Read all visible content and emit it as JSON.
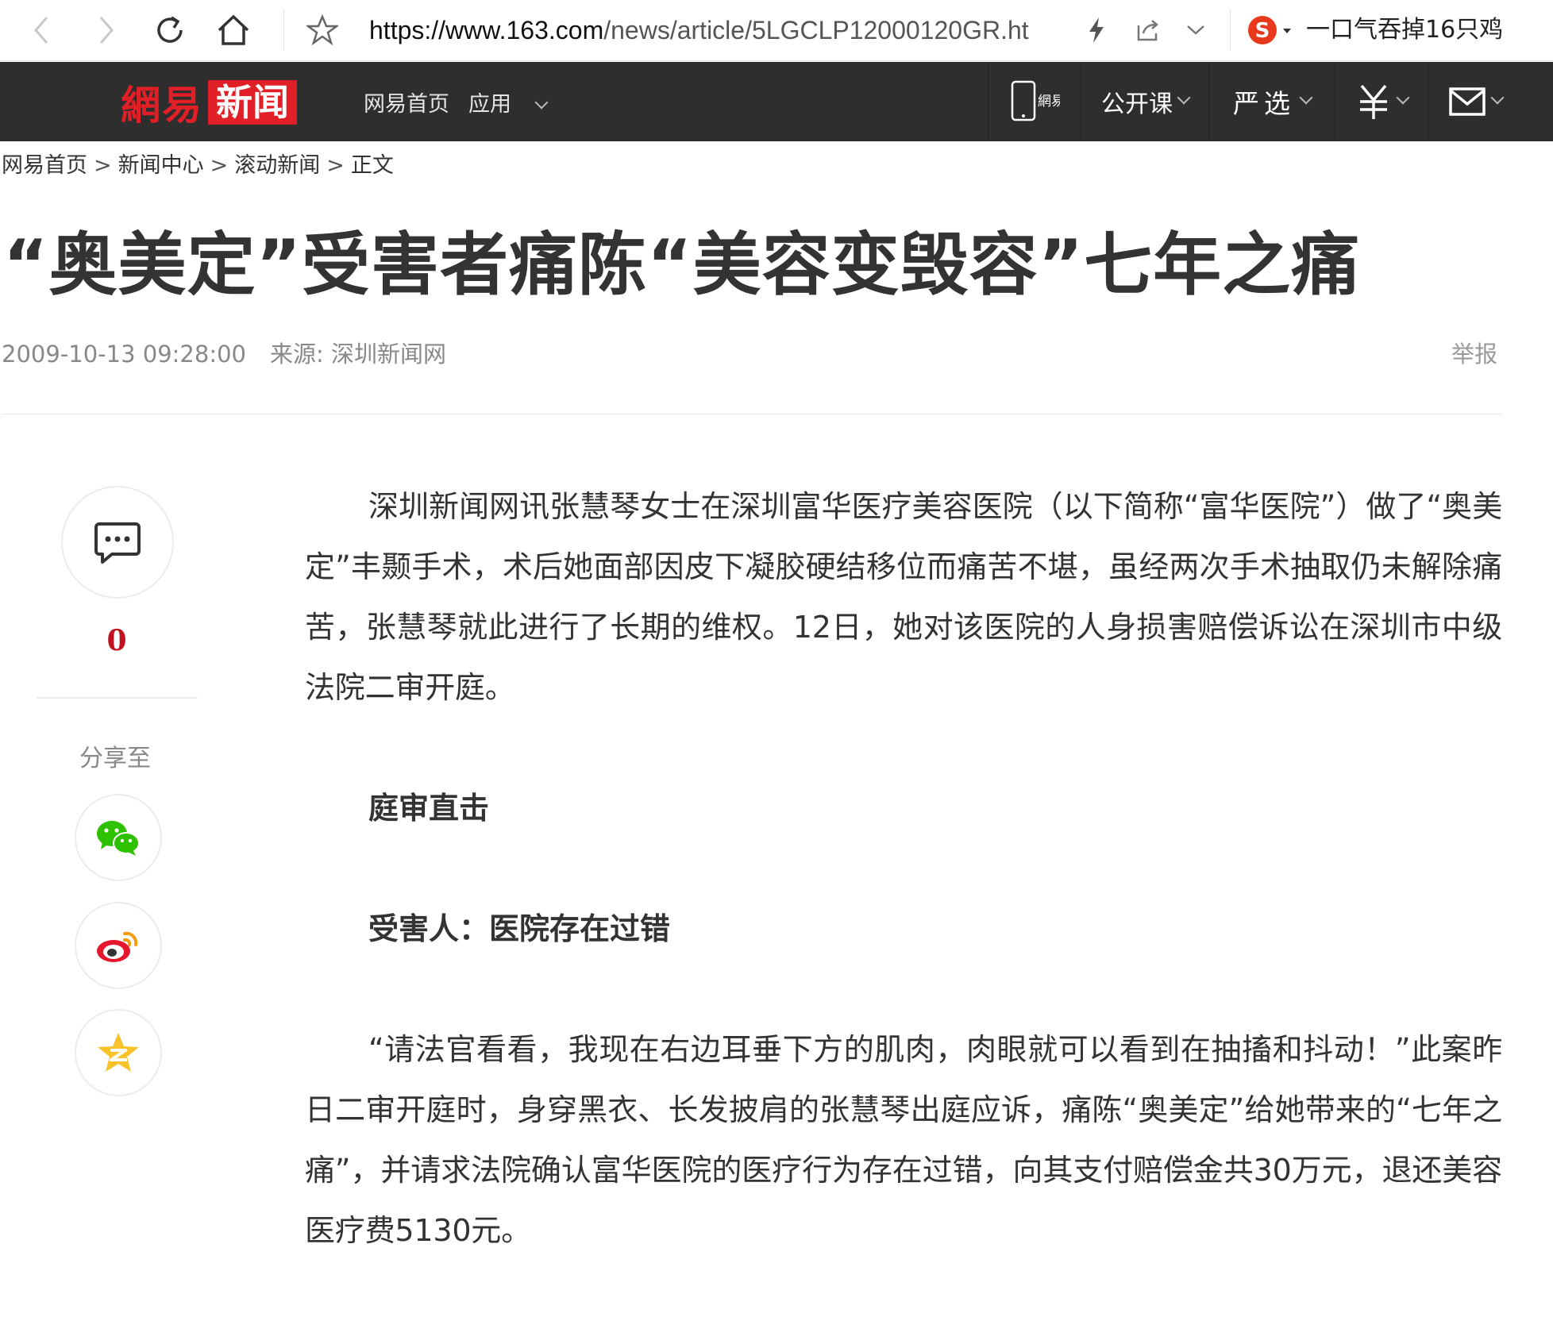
{
  "browser": {
    "url_host": "https://www.163.com",
    "url_path": "/news/article/5LGCLP12000120GR.ht",
    "search_hint": "一口气吞掉16只鸡"
  },
  "site_nav": {
    "logo_part1": "網易",
    "logo_part2": "新闻",
    "links": [
      "网易首页",
      "应用"
    ],
    "right_items": {
      "app_label": "網易",
      "open_course": "公开课",
      "yanxuan": "严选"
    }
  },
  "breadcrumb": [
    "网易首页",
    "新闻中心",
    "滚动新闻",
    "正文"
  ],
  "article": {
    "title": "“奥美定”受害者痛陈“美容变毁容”七年之痛",
    "date": "2009-10-13 09:28:00",
    "source": "来源: 深圳新闻网",
    "report_label": "举报",
    "paragraphs": [
      "深圳新闻网讯张慧琴女士在深圳富华医疗美容医院（以下简称“富华医院”）做了“奥美定”丰颞手术，术后她面部因皮下凝胶硬结移位而痛苦不堪，虽经两次手术抽取仍未解除痛苦，张慧琴就此进行了长期的维权。12日，她对该医院的人身损害赔偿诉讼在深圳市中级法院二审开庭。",
      "“请法官看看，我现在右边耳垂下方的肌肉，肉眼就可以看到在抽搐和抖动！”此案昨日二审开庭时，身穿黑衣、长发披肩的张慧琴出庭应诉，痛陈“奥美定”给她带来的“七年之痛”，并请求法院确认富华医院的医疗行为存在过错，向其支付赔偿金共30万元，退还美容医疗费5130元。"
    ],
    "subheads": [
      "庭审直击",
      "受害人：医院存在过错"
    ]
  },
  "side": {
    "comment_count": "0",
    "share_label": "分享至"
  },
  "colors": {
    "brand_red": "#e01f27",
    "nav_bg": "#2e2e2e",
    "count_red": "#c1121f"
  }
}
